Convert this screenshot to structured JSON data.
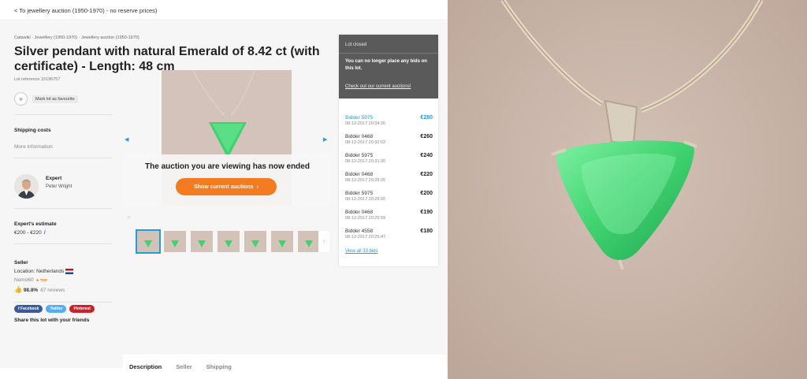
{
  "top": {
    "back_link": "< To jewellery auction (1950-1970) - no reserve prices)"
  },
  "breadcrumb": "Catawiki · Jewellery (1950-1970) · Jewellery auction (1950-1970)",
  "lot": {
    "title": "Silver pendant with natural Emerald of 8.42 ct (with certificate) - Length: 48 cm",
    "reference": "Lot reference 15195757",
    "favourite_label": "Mark lot as favourite"
  },
  "sidebar": {
    "shipping_label": "Shipping costs",
    "more_info": "More information",
    "expert_role": "Expert",
    "expert_name": "Peter Wright",
    "estimate_label": "Expert's estimate",
    "estimate_value": "€200 - €220",
    "seller_label": "Seller",
    "seller_location": "Location: Netherlands",
    "seller_name": "Nemo60",
    "seller_badge": "★ TOP",
    "seller_rating": "98.8%",
    "seller_reviews": "87 reviews",
    "share_label": "Share this lot with your friends",
    "share_buttons": [
      "f Facebook",
      "Twitter",
      "Pinterest"
    ]
  },
  "gallery": {
    "ended_text": "The auction you are viewing has now ended",
    "show_button": "Show current auctions",
    "thumb_count": 7
  },
  "bids_panel": {
    "status": "Lot closed",
    "message": "You can no longer place any bids on this lot.",
    "link": "Check out our current auctions!",
    "bids": [
      {
        "bidder": "Bidder 5975",
        "date": "08-12-2017 20:34:26",
        "amount": "€280"
      },
      {
        "bidder": "Bidder 0468",
        "date": "08-12-2017 20:32:02",
        "amount": "€260"
      },
      {
        "bidder": "Bidder 5975",
        "date": "08-12-2017 20:31:20",
        "amount": "€240"
      },
      {
        "bidder": "Bidder 0468",
        "date": "08-12-2017 20:29:20",
        "amount": "€220"
      },
      {
        "bidder": "Bidder 5975",
        "date": "08-12-2017 20:28:20",
        "amount": "€200"
      },
      {
        "bidder": "Bidder 0468",
        "date": "08-12-2017 20:25:59",
        "amount": "€190"
      },
      {
        "bidder": "Bidder 4558",
        "date": "08-12-2017 20:25:47",
        "amount": "€180"
      }
    ],
    "view_all": "View all 33 bids"
  },
  "tabs": [
    "Description",
    "Seller",
    "Shipping"
  ],
  "colors": {
    "accent_orange": "#f47b20",
    "link_blue": "#2a9ad5",
    "panel_dark": "#5a5a5a",
    "emerald": "#3fd26f"
  }
}
